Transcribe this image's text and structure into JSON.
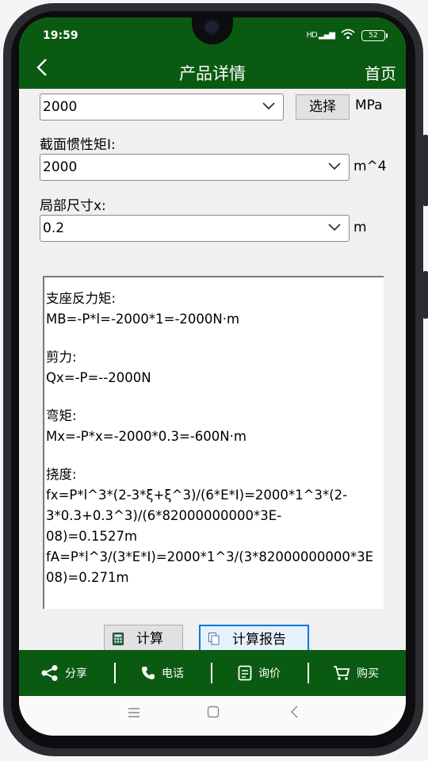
{
  "status": {
    "time": "19:59",
    "signal": "HD",
    "battery": "52"
  },
  "nav": {
    "back": "<",
    "title": "产品详情",
    "home": "首页"
  },
  "form": {
    "e_value": "2000",
    "choose_label": "选择",
    "e_unit": "MPa",
    "inertia_label": "截面惯性矩I:",
    "inertia_value": "2000",
    "inertia_unit": "m^4",
    "local_label": "局部尺寸x:",
    "local_value": "0.2",
    "local_unit": "m"
  },
  "result_lines": {
    "l1": "支座反力矩:",
    "l2": "MB=-P*l=-2000*1=-2000N·m",
    "l3": "剪力:",
    "l4": "Qx=-P=--2000N",
    "l5": "弯矩:",
    "l6": "Mx=-P*x=-2000*0.3=-600N·m",
    "l7": "挠度:",
    "l8": "fx=P*l^3*(2-3*ξ+ξ^3)/(6*E*I)=2000*1^3*(2-",
    "l9": "3*0.3+0.3^3)/(6*82000000000*3E-",
    "l10": "08)=0.1527m",
    "l11": "fA=P*l^3/(3*E*I)=2000*1^3/(3*82000000000*3E",
    "l12": "08)=0.271m"
  },
  "buttons": {
    "calc": "计算",
    "report": "计算报告"
  },
  "toolbar": {
    "share": "分享",
    "phone": "电话",
    "inquiry": "询价",
    "buy": "购买"
  },
  "colors": {
    "brand_green": "#0b5a12",
    "button_blue": "#0078d7"
  },
  "icons": [
    "back-chevron-icon",
    "chevron-down-icon",
    "calculator-icon",
    "document-icon",
    "share-icon",
    "phone-icon",
    "inquiry-doc-icon",
    "cart-icon",
    "menu-icon",
    "home-square-icon",
    "back-triangle-icon"
  ]
}
